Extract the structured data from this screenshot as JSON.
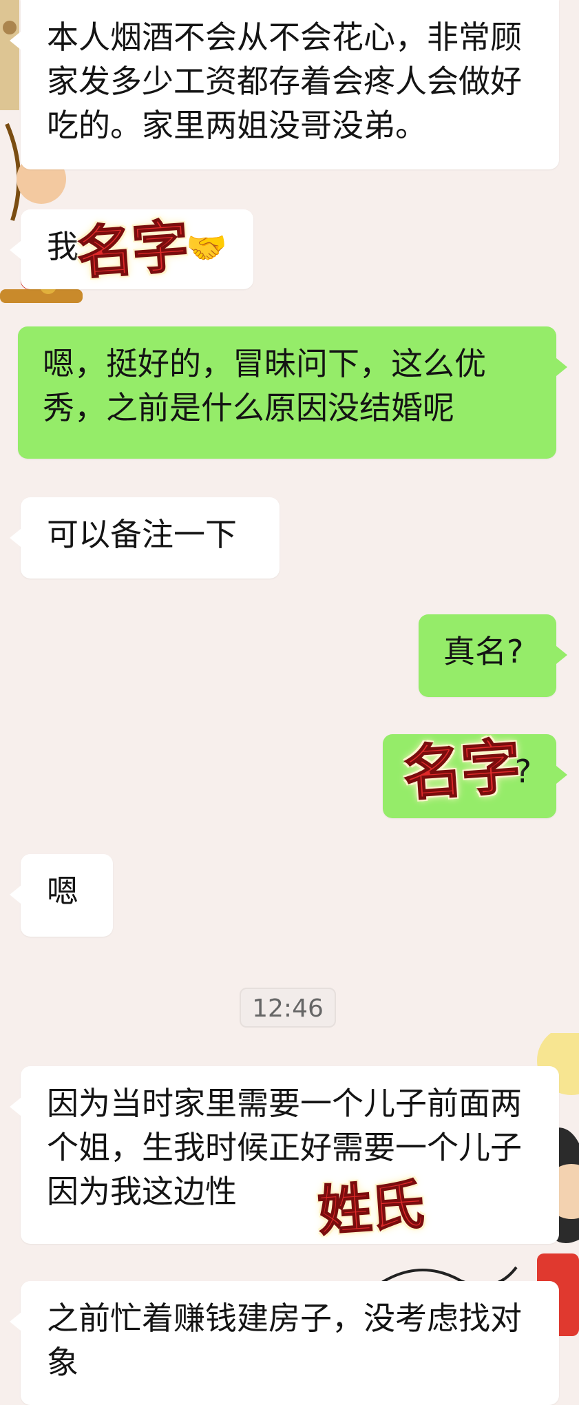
{
  "chat": {
    "messages": [
      {
        "side": "incoming",
        "text": "本人烟酒不会从不会花心，非常顾家发多少工资都存着会疼人会做好吃的。家里两姐没哥没弟。"
      },
      {
        "side": "incoming",
        "text": "我",
        "emoji": "🤝",
        "redacted_sticker": "名字"
      },
      {
        "side": "outgoing",
        "text": "嗯，挺好的，冒昧问下，这么优秀，之前是什么原因没结婚呢"
      },
      {
        "side": "incoming",
        "text": "可以备注一下"
      },
      {
        "side": "outgoing",
        "text": "真名?"
      },
      {
        "side": "outgoing",
        "text": "?",
        "redacted_sticker": "名字"
      },
      {
        "side": "incoming",
        "text": "嗯"
      },
      {
        "side": "incoming",
        "text": "因为当时家里需要一个儿子前面两个姐，生我时候正好需要一个儿子因为我这边性",
        "redacted_sticker": "姓氏"
      },
      {
        "side": "incoming",
        "text": "之前忙着赚钱建房子，没考虑找对象"
      }
    ],
    "timestamp": "12:46"
  },
  "colors": {
    "background": "#f7efec",
    "incoming_bubble": "#ffffff",
    "outgoing_bubble": "#95ec69",
    "sticker_red": "#e02a2a"
  }
}
